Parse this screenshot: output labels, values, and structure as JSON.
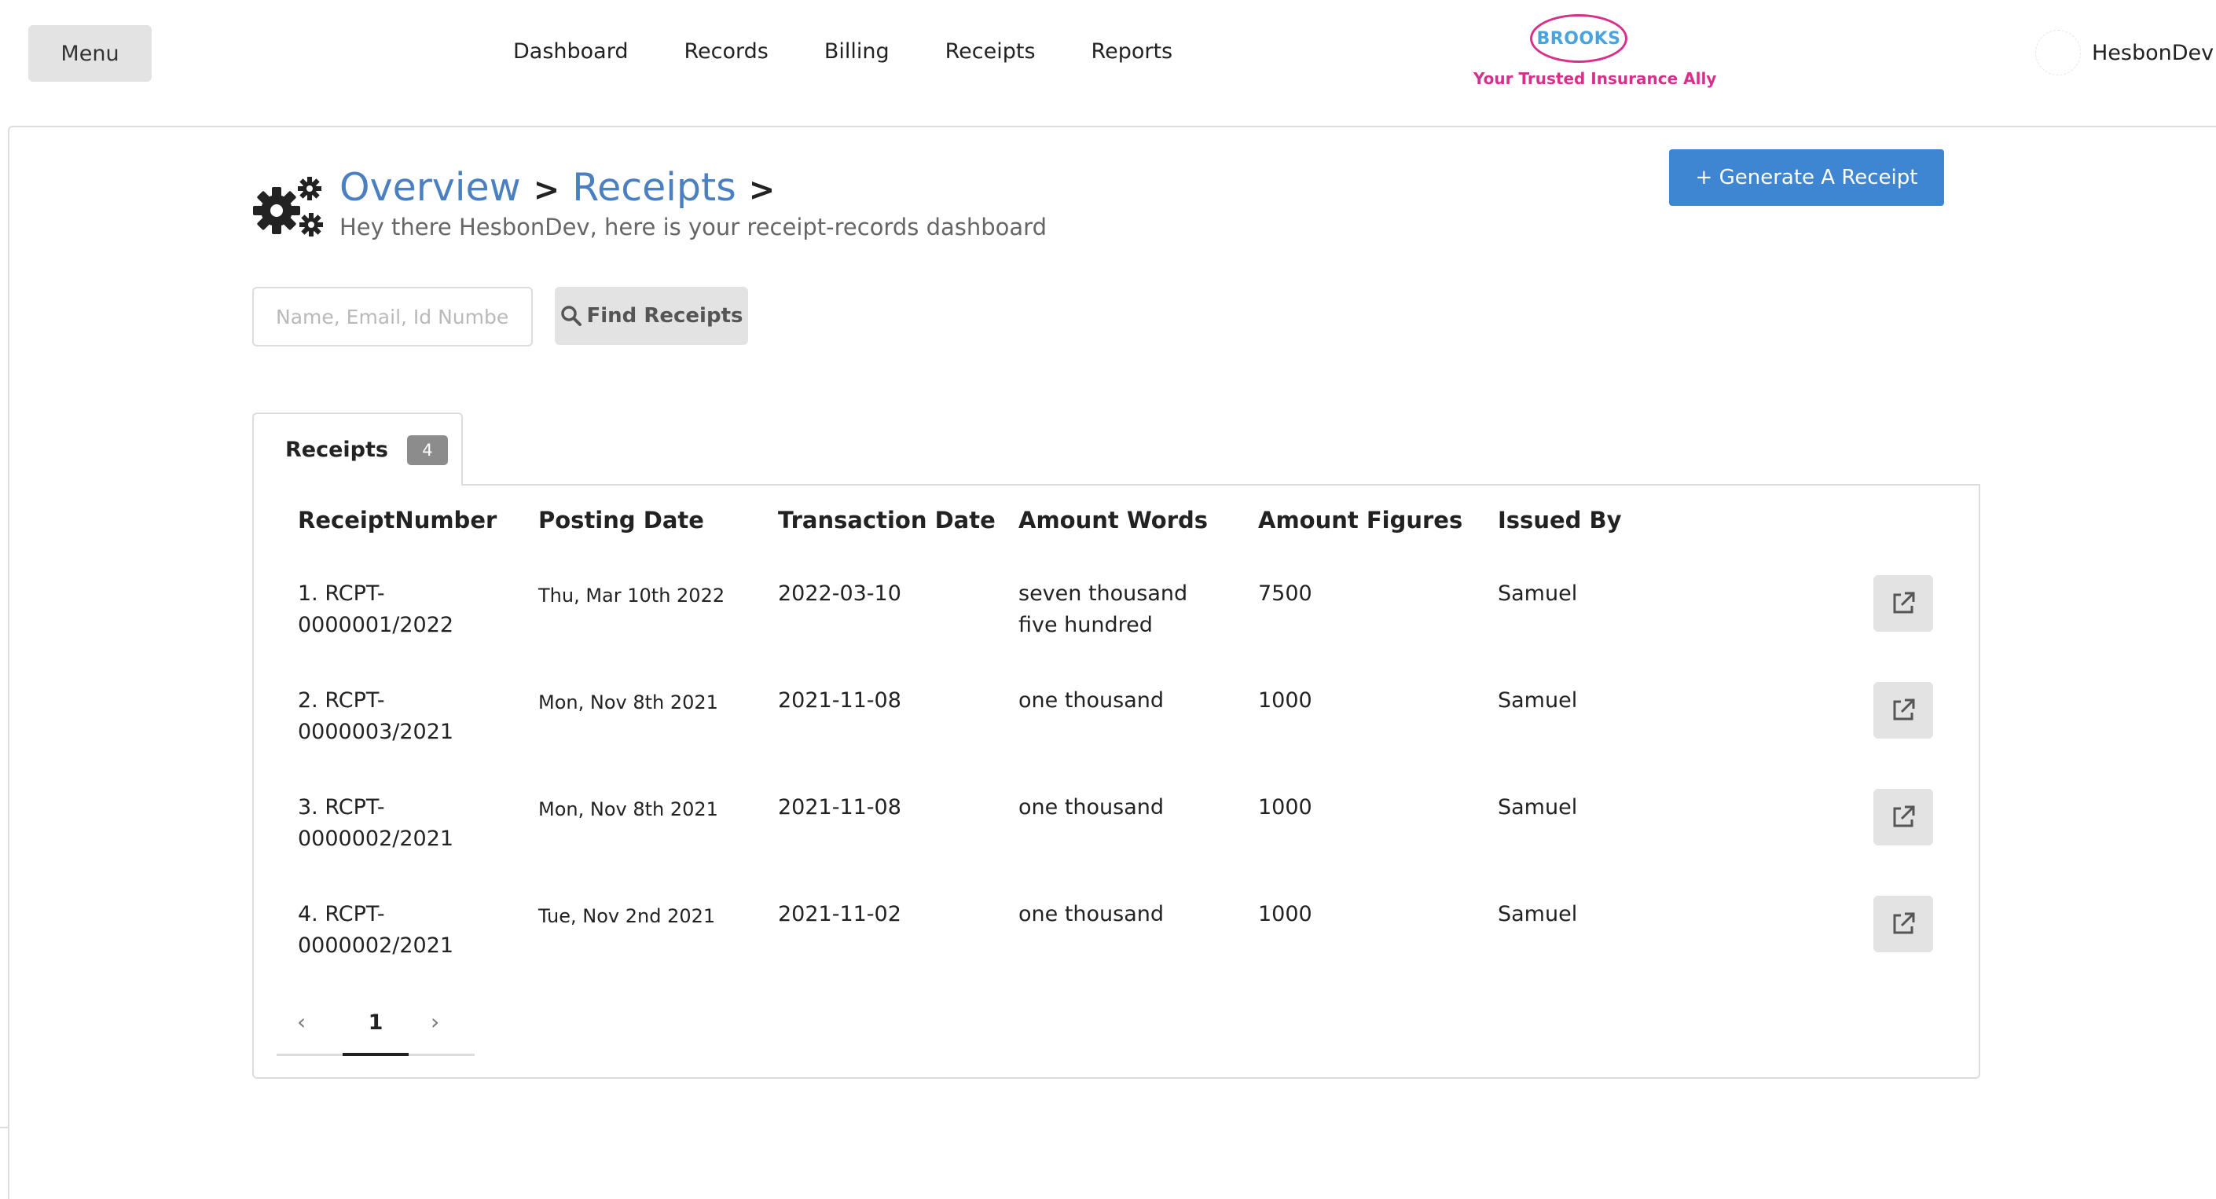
{
  "topbar": {
    "menu_label": "Menu",
    "nav": [
      "Dashboard",
      "Records",
      "Billing",
      "Receipts",
      "Reports"
    ],
    "logo": {
      "name": "BROOKS",
      "tagline": "Your Trusted Insurance Ally"
    },
    "username": "HesbonDev"
  },
  "header": {
    "breadcrumb": [
      "Overview",
      "Receipts"
    ],
    "separator": ">",
    "subtitle": "Hey there HesbonDev, here is your receipt-records dashboard",
    "generate_label": "+ Generate A Receipt"
  },
  "search": {
    "placeholder": "Name, Email, Id Number",
    "button_label": "Find Receipts"
  },
  "tab": {
    "label": "Receipts",
    "count": "4"
  },
  "table": {
    "columns": [
      "ReceiptNumber",
      "Posting Date",
      "Transaction Date",
      "Amount Words",
      "Amount Figures",
      "Issued By"
    ],
    "rows": [
      {
        "receipt": "1. RCPT-0000001/2022",
        "posting": "Thu, Mar 10th 2022",
        "txdate": "2022-03-10",
        "words": "seven thousand five hundred",
        "figures": "7500",
        "issued": "Samuel"
      },
      {
        "receipt": "2. RCPT-0000003/2021",
        "posting": "Mon, Nov 8th 2021",
        "txdate": "2021-11-08",
        "words": "one thousand",
        "figures": "1000",
        "issued": "Samuel"
      },
      {
        "receipt": "3. RCPT-0000002/2021",
        "posting": "Mon, Nov 8th 2021",
        "txdate": "2021-11-08",
        "words": "one thousand",
        "figures": "1000",
        "issued": "Samuel"
      },
      {
        "receipt": "4. RCPT-0000002/2021",
        "posting": "Tue, Nov 2nd 2021",
        "txdate": "2021-11-02",
        "words": "one thousand",
        "figures": "1000",
        "issued": "Samuel"
      }
    ]
  },
  "pagination": {
    "prev": "‹",
    "page": "1",
    "next": "›"
  },
  "colors": {
    "primary": "#3f86d2",
    "link": "#4a7fc1",
    "logo_pink": "#d8308a",
    "logo_blue": "#4aa3df"
  },
  "icons": {
    "header": "gears-icon",
    "find": "search-icon",
    "row_action": "external-link-icon"
  }
}
